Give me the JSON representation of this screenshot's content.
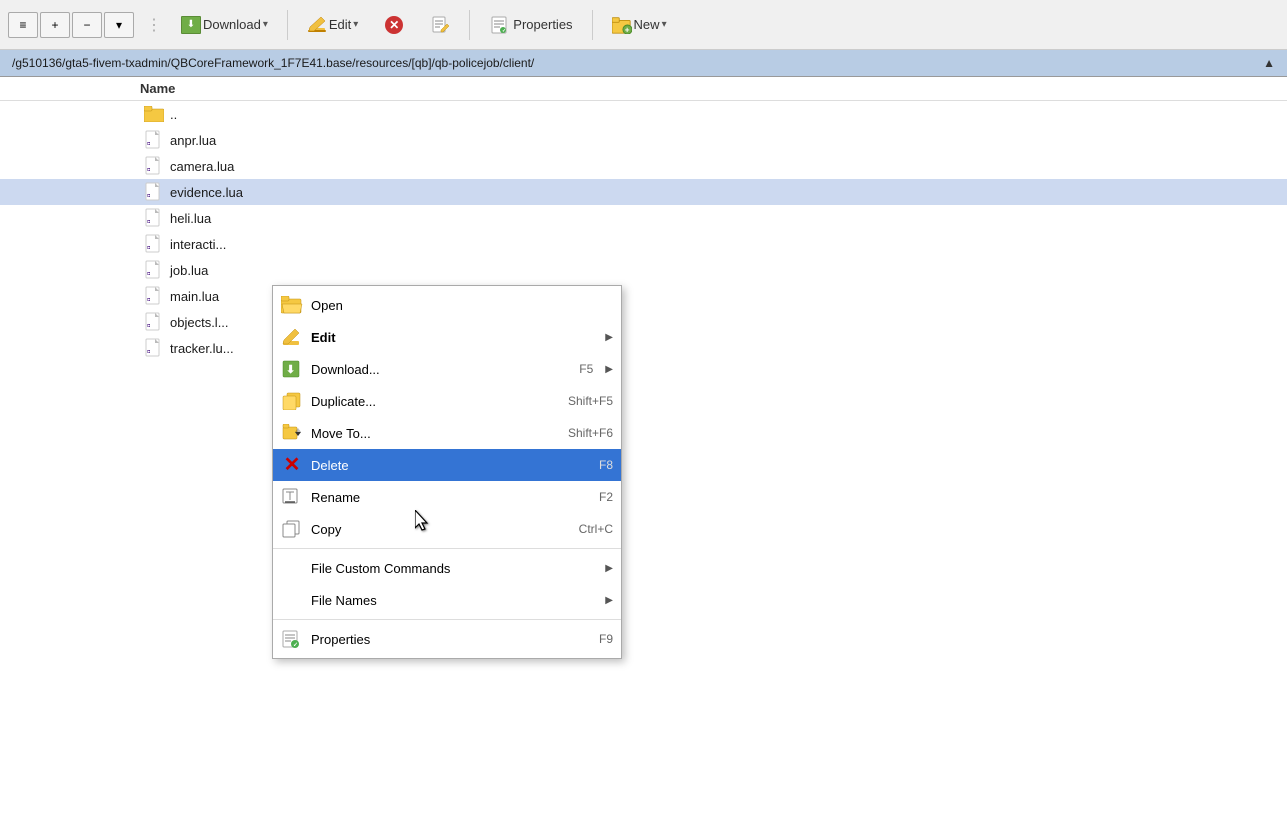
{
  "toolbar": {
    "download_label": "Download",
    "edit_label": "Edit",
    "cancel_label": "✕",
    "properties_label": "Properties",
    "new_label": "New",
    "new_dropdown": "▾",
    "download_dropdown": "▾",
    "edit_dropdown": "▾"
  },
  "window_controls": {
    "hamburger": "≡",
    "plus": "+",
    "minus": "−",
    "chevron": "▾"
  },
  "address_bar": {
    "path": "/g510136/gta5-fivem-txadmin/QBCoreFramework_1F7E41.base/resources/[qb]/qb-policejob/client/",
    "collapse": "▲"
  },
  "file_list": {
    "header": "Name",
    "items": [
      {
        "name": "..",
        "type": "parent"
      },
      {
        "name": "anpr.lua",
        "type": "lua"
      },
      {
        "name": "camera.lua",
        "type": "lua"
      },
      {
        "name": "evidence.lua",
        "type": "lua",
        "selected": true
      },
      {
        "name": "heli.lua",
        "type": "lua"
      },
      {
        "name": "interacti...",
        "type": "lua"
      },
      {
        "name": "job.lua",
        "type": "lua"
      },
      {
        "name": "main.lua",
        "type": "lua"
      },
      {
        "name": "objects.l...",
        "type": "lua"
      },
      {
        "name": "tracker.lu...",
        "type": "lua"
      }
    ]
  },
  "context_menu": {
    "items": [
      {
        "id": "open",
        "label": "Open",
        "shortcut": "",
        "bold": false,
        "has_arrow": false,
        "icon": "open-folder"
      },
      {
        "id": "edit",
        "label": "Edit",
        "shortcut": "",
        "bold": true,
        "has_arrow": true,
        "icon": "pencil"
      },
      {
        "id": "download",
        "label": "Download...",
        "shortcut": "F5",
        "bold": false,
        "has_arrow": true,
        "icon": "download-page"
      },
      {
        "id": "duplicate",
        "label": "Duplicate...",
        "shortcut": "Shift+F5",
        "bold": false,
        "has_arrow": false,
        "icon": "duplicate"
      },
      {
        "id": "moveto",
        "label": "Move To...",
        "shortcut": "Shift+F6",
        "bold": false,
        "has_arrow": false,
        "icon": "move"
      },
      {
        "id": "delete",
        "label": "Delete",
        "shortcut": "F8",
        "bold": false,
        "has_arrow": false,
        "icon": "delete",
        "highlighted": true
      },
      {
        "id": "rename",
        "label": "Rename",
        "shortcut": "F2",
        "bold": false,
        "has_arrow": false,
        "icon": "rename"
      },
      {
        "id": "copy",
        "label": "Copy",
        "shortcut": "Ctrl+C",
        "bold": false,
        "has_arrow": false,
        "icon": "copy"
      },
      {
        "id": "file-custom",
        "label": "File Custom Commands",
        "shortcut": "",
        "bold": false,
        "has_arrow": true,
        "icon": "none",
        "separator_before": true
      },
      {
        "id": "file-names",
        "label": "File Names",
        "shortcut": "",
        "bold": false,
        "has_arrow": true,
        "icon": "none"
      },
      {
        "id": "properties",
        "label": "Properties",
        "shortcut": "F9",
        "bold": false,
        "has_arrow": false,
        "icon": "properties",
        "separator_before": true
      }
    ]
  }
}
